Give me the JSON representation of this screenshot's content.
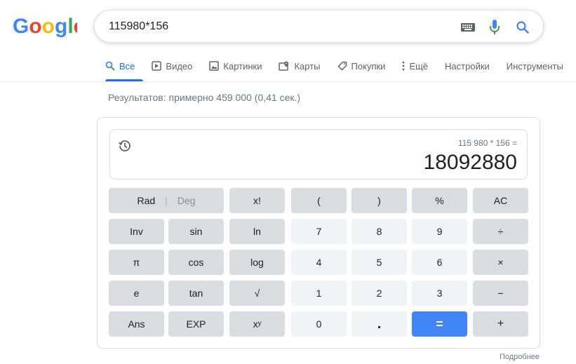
{
  "logo_text": "Google",
  "search": {
    "query": "115980*156"
  },
  "tabs": [
    {
      "label": "Все",
      "icon": "search-icon"
    },
    {
      "label": "Видео",
      "icon": "video-icon"
    },
    {
      "label": "Картинки",
      "icon": "image-icon"
    },
    {
      "label": "Карты",
      "icon": "map-icon"
    },
    {
      "label": "Покупки",
      "icon": "tag-icon"
    },
    {
      "label": "Ещё",
      "icon": "more-vert-icon"
    },
    {
      "label": "Настройки"
    },
    {
      "label": "Инструменты"
    }
  ],
  "results_stats": "Результатов: примерно 459 000 (0,41 сек.)",
  "calculator": {
    "expression": "115 980 * 156 =",
    "result": "18092880",
    "rad": "Rad",
    "deg": "Deg",
    "keys": {
      "fact": "x!",
      "lparen": "(",
      "rparen": ")",
      "percent": "%",
      "ac": "AC",
      "inv": "Inv",
      "sin": "sin",
      "ln": "ln",
      "seven": "7",
      "eight": "8",
      "nine": "9",
      "divide": "÷",
      "pi": "π",
      "cos": "cos",
      "log": "log",
      "four": "4",
      "five": "5",
      "six": "6",
      "multiply": "×",
      "e": "e",
      "tan": "tan",
      "sqrt": "√",
      "one": "1",
      "two": "2",
      "three": "3",
      "minus": "−",
      "ans": "Ans",
      "exp": "EXP",
      "pow": "xʸ",
      "zero": "0",
      "dot": ".",
      "equals": "=",
      "plus": "+"
    }
  },
  "more_label": "Подробнее",
  "colors": {
    "accent": "#1a73e8",
    "equals": "#4285f4"
  }
}
